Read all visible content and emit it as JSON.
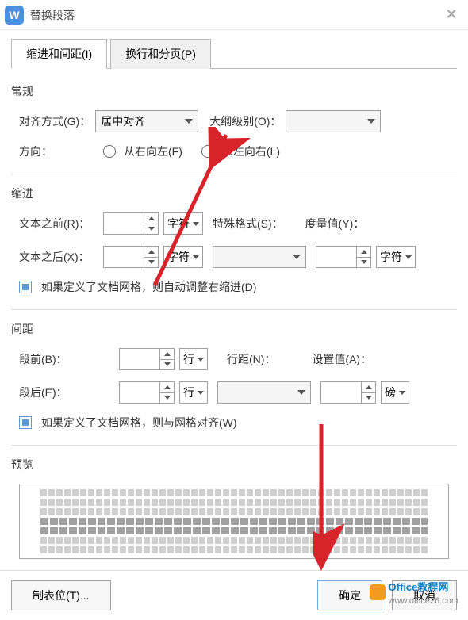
{
  "titlebar": {
    "app_glyph": "W",
    "title": "替换段落"
  },
  "tabs": {
    "tab1": "缩进和间距(I)",
    "tab2": "换行和分页(P)"
  },
  "general": {
    "heading": "常规",
    "align_label": "对齐方式(G)：",
    "align_value": "居中对齐",
    "outline_label": "大纲级别(O)：",
    "direction_label": "方向：",
    "rtl_label": "从右向左(F)",
    "ltr_label": "从左向右(L)"
  },
  "indent": {
    "heading": "缩进",
    "before_label": "文本之前(R)：",
    "after_label": "文本之后(X)：",
    "unit_chars": "字符",
    "special_label": "特殊格式(S)：",
    "measure_label": "度量值(Y)：",
    "checkbox_label": "如果定义了文档网格，则自动调整右缩进(D)"
  },
  "spacing": {
    "heading": "间距",
    "before_label": "段前(B)：",
    "after_label": "段后(E)：",
    "unit_lines": "行",
    "line_label": "行距(N)：",
    "setvalue_label": "设置值(A)：",
    "unit_pound": "磅",
    "checkbox_label": "如果定义了文档网格，则与网格对齐(W)"
  },
  "preview": {
    "heading": "预览"
  },
  "footer": {
    "tabstops": "制表位(T)...",
    "ok": "确定",
    "cancel": "取消"
  },
  "watermark": {
    "brand": "Office",
    "sub": "教程网",
    "url": "www.office26.com"
  }
}
